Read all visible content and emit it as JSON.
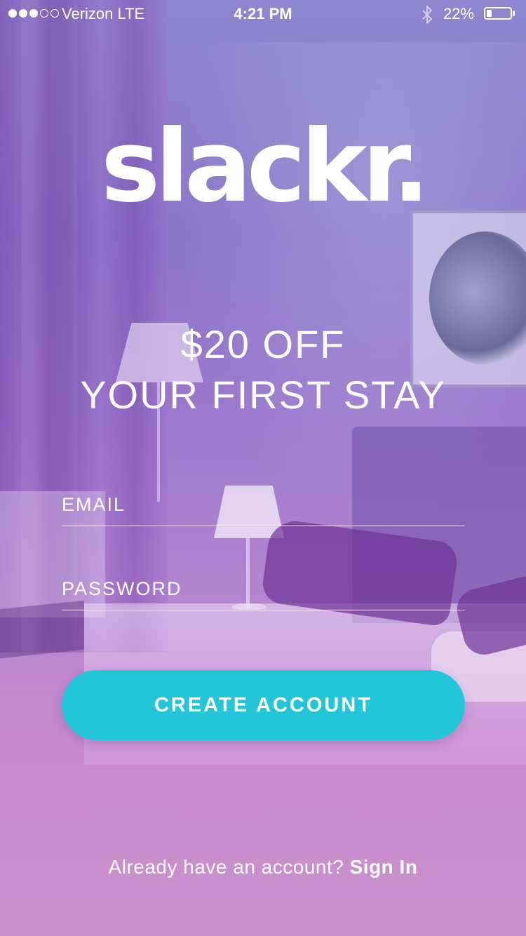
{
  "status_bar": {
    "carrier": "Verizon LTE",
    "time": "4:21 PM",
    "battery_percent": "22%",
    "battery_level": 0.22,
    "signal_bars_filled": 3,
    "signal_bars_total": 5,
    "bluetooth_glyph": "✳"
  },
  "brand": {
    "logo_text": "slackr."
  },
  "promo": {
    "line1": "$20 OFF",
    "line2": "YOUR FIRST STAY"
  },
  "form": {
    "email_placeholder": "EMAIL",
    "password_placeholder": "PASSWORD",
    "email_value": "",
    "password_value": ""
  },
  "actions": {
    "create_account_label": "CREATE ACCOUNT",
    "signin_prompt": "Already have an account?",
    "signin_label": "Sign In"
  },
  "colors": {
    "accent": "#22c6d8",
    "text": "#ffffff",
    "gradient_top": "#8f86cf",
    "gradient_bottom": "#c98acb"
  },
  "icons": [
    "signal-icon",
    "bluetooth-icon",
    "battery-icon"
  ]
}
